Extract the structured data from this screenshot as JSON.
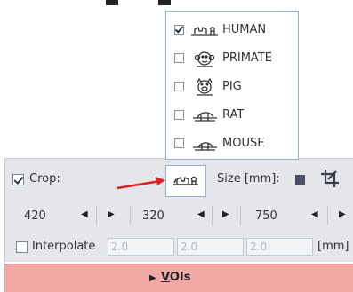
{
  "menu": {
    "items": [
      {
        "label": "HUMAN",
        "checked": true,
        "icon": "human-icon"
      },
      {
        "label": "PRIMATE",
        "checked": false,
        "icon": "primate-icon"
      },
      {
        "label": "PIG",
        "checked": false,
        "icon": "pig-icon"
      },
      {
        "label": "RAT",
        "checked": false,
        "icon": "rat-icon"
      },
      {
        "label": "MOUSE",
        "checked": false,
        "icon": "mouse-icon"
      }
    ]
  },
  "crop": {
    "label": "Crop:",
    "checked": true,
    "species_icon": "human-icon"
  },
  "size": {
    "label": "Size [mm]:"
  },
  "dims": {
    "x": "420",
    "y": "320",
    "z": "750"
  },
  "interpolate": {
    "label": "Interpolate",
    "checked": false,
    "values": [
      "2.0",
      "2.0",
      "2.0"
    ],
    "unit": "[mm]"
  },
  "vois": {
    "first": "V",
    "rest": "OIs"
  },
  "colors": {
    "accent_red": "#e02020",
    "vois_bg": "#f2a9a6",
    "panel_bg": "#e4e6ea",
    "menu_border": "#8fb0d8"
  }
}
